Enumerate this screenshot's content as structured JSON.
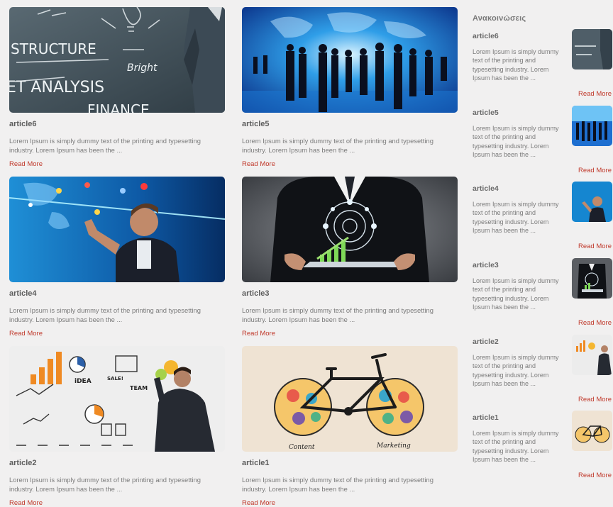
{
  "colors": {
    "link": "#c0392b",
    "background": "#f1f0f0"
  },
  "articles": [
    {
      "title": "article6",
      "excerpt": "Lorem Ipsum is simply dummy text of the printing and typesetting industry. Lorem Ipsum has been the ...",
      "read_more": "Read More",
      "image": "business-analysis-chalkboard"
    },
    {
      "title": "article5",
      "excerpt": "Lorem Ipsum is simply dummy text of the printing and typesetting industry. Lorem Ipsum has been the ...",
      "read_more": "Read More",
      "image": "business-people-world-map"
    },
    {
      "title": "article4",
      "excerpt": "Lorem Ipsum is simply dummy text of the printing and typesetting industry. Lorem Ipsum has been the ...",
      "read_more": "Read More",
      "image": "man-touching-digital-world-map"
    },
    {
      "title": "article3",
      "excerpt": "Lorem Ipsum is simply dummy text of the printing and typesetting industry. Lorem Ipsum has been the ...",
      "read_more": "Read More",
      "image": "tablet-holographic-chart"
    },
    {
      "title": "article2",
      "excerpt": "Lorem Ipsum is simply dummy text of the printing and typesetting industry. Lorem Ipsum has been the ...",
      "read_more": "Read More",
      "image": "man-drawing-business-sketches"
    },
    {
      "title": "article1",
      "excerpt": "Lorem Ipsum is simply dummy text of the printing and typesetting industry. Lorem Ipsum has been the ...",
      "read_more": "Read More",
      "image": "content-marketing-bicycle"
    }
  ],
  "sidebar": {
    "heading": "Ανακοινώσεις",
    "items": [
      {
        "title": "article6",
        "excerpt": "Lorem Ipsum is simply dummy text of the printing and typesetting industry. Lorem Ipsum has been the ...",
        "read_more": "Read More"
      },
      {
        "title": "article5",
        "excerpt": "Lorem Ipsum is simply dummy text of the printing and typesetting industry. Lorem Ipsum has been the ...",
        "read_more": "Read More"
      },
      {
        "title": "article4",
        "excerpt": "Lorem Ipsum is simply dummy text of the printing and typesetting industry. Lorem Ipsum has been the ...",
        "read_more": "Read More"
      },
      {
        "title": "article3",
        "excerpt": "Lorem Ipsum is simply dummy text of the printing and typesetting industry. Lorem Ipsum has been the ...",
        "read_more": "Read More"
      },
      {
        "title": "article2",
        "excerpt": "Lorem Ipsum is simply dummy text of the printing and typesetting industry. Lorem Ipsum has been the ...",
        "read_more": "Read More"
      },
      {
        "title": "article1",
        "excerpt": "Lorem Ipsum is simply dummy text of the printing and typesetting industry. Lorem Ipsum has been the ...",
        "read_more": "Read More"
      }
    ]
  },
  "image_text": {
    "structure": "STRUCTURE",
    "analysis": "ET ANALYSIS",
    "finance": "FINANCE",
    "bright": "Bright",
    "content": "Content",
    "marketing": "Marketing",
    "idea": "iDEA",
    "team": "TEAM",
    "sale": "SALE!"
  }
}
